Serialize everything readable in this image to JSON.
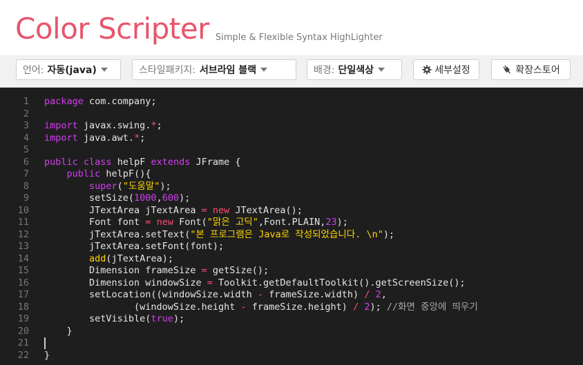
{
  "brand": {
    "logo_text": "Color Scripter",
    "tagline": "Simple & Flexible Syntax HighLighter"
  },
  "toolbar": {
    "language": {
      "label": "언어:",
      "value": "자동(java)"
    },
    "style_package": {
      "label": "스타일패키지:",
      "value": "서브라임 블랙"
    },
    "background": {
      "label": "배경:",
      "value": "단일색상"
    },
    "settings_label": "세부설정",
    "extensions_label": "확장스토어"
  },
  "editor": {
    "line_numbers": [
      "1",
      "2",
      "3",
      "4",
      "5",
      "6",
      "7",
      "8",
      "9",
      "10",
      "11",
      "12",
      "13",
      "14",
      "15",
      "16",
      "17",
      "18",
      "19",
      "20",
      "21",
      "22"
    ],
    "cursor_line": 21,
    "lines": [
      [
        {
          "t": "kw",
          "v": "package"
        },
        {
          "t": "pl",
          "v": " com.company;"
        }
      ],
      [],
      [
        {
          "t": "kw",
          "v": "import"
        },
        {
          "t": "pl",
          "v": " javax.swing."
        },
        {
          "t": "op",
          "v": "*"
        },
        {
          "t": "pl",
          "v": ";"
        }
      ],
      [
        {
          "t": "kw",
          "v": "import"
        },
        {
          "t": "pl",
          "v": " java.awt."
        },
        {
          "t": "op",
          "v": "*"
        },
        {
          "t": "pl",
          "v": ";"
        }
      ],
      [],
      [
        {
          "t": "kw",
          "v": "public"
        },
        {
          "t": "pl",
          "v": " "
        },
        {
          "t": "kw",
          "v": "class"
        },
        {
          "t": "pl",
          "v": " helpF "
        },
        {
          "t": "kw",
          "v": "extends"
        },
        {
          "t": "pl",
          "v": " JFrame {"
        }
      ],
      [
        {
          "t": "pl",
          "v": "    "
        },
        {
          "t": "kw",
          "v": "public"
        },
        {
          "t": "pl",
          "v": " helpF(){"
        }
      ],
      [
        {
          "t": "pl",
          "v": "        "
        },
        {
          "t": "kw",
          "v": "super"
        },
        {
          "t": "pl",
          "v": "("
        },
        {
          "t": "str",
          "v": "\"도움말\""
        },
        {
          "t": "pl",
          "v": ");"
        }
      ],
      [
        {
          "t": "pl",
          "v": "        setSize("
        },
        {
          "t": "num",
          "v": "1000"
        },
        {
          "t": "pl",
          "v": ","
        },
        {
          "t": "num",
          "v": "600"
        },
        {
          "t": "pl",
          "v": ");"
        }
      ],
      [
        {
          "t": "pl",
          "v": "        JTextArea jTextArea "
        },
        {
          "t": "op",
          "v": "="
        },
        {
          "t": "pl",
          "v": " "
        },
        {
          "t": "op",
          "v": "new"
        },
        {
          "t": "pl",
          "v": " JTextArea();"
        }
      ],
      [
        {
          "t": "pl",
          "v": "        Font font "
        },
        {
          "t": "op",
          "v": "="
        },
        {
          "t": "pl",
          "v": " "
        },
        {
          "t": "op",
          "v": "new"
        },
        {
          "t": "pl",
          "v": " Font("
        },
        {
          "t": "str",
          "v": "\"맑은 고딕\""
        },
        {
          "t": "pl",
          "v": ",Font.PLAIN,"
        },
        {
          "t": "num",
          "v": "23"
        },
        {
          "t": "pl",
          "v": ");"
        }
      ],
      [
        {
          "t": "pl",
          "v": "        jTextArea.setText("
        },
        {
          "t": "str",
          "v": "\"본 프로그램은 Java로 작성되었습니다. \\n\""
        },
        {
          "t": "pl",
          "v": ");"
        }
      ],
      [
        {
          "t": "pl",
          "v": "        jTextArea.setFont(font);"
        }
      ],
      [
        {
          "t": "pl",
          "v": "        "
        },
        {
          "t": "fn",
          "v": "add"
        },
        {
          "t": "pl",
          "v": "(jTextArea);"
        }
      ],
      [
        {
          "t": "pl",
          "v": "        Dimension frameSize "
        },
        {
          "t": "op",
          "v": "="
        },
        {
          "t": "pl",
          "v": " getSize();"
        }
      ],
      [
        {
          "t": "pl",
          "v": "        Dimension windowSize "
        },
        {
          "t": "op",
          "v": "="
        },
        {
          "t": "pl",
          "v": " Toolkit.getDefaultToolkit().getScreenSize();"
        }
      ],
      [
        {
          "t": "pl",
          "v": "        setLocation((windowSize.width "
        },
        {
          "t": "op",
          "v": "-"
        },
        {
          "t": "pl",
          "v": " frameSize.width) "
        },
        {
          "t": "op",
          "v": "/"
        },
        {
          "t": "pl",
          "v": " "
        },
        {
          "t": "num",
          "v": "2"
        },
        {
          "t": "pl",
          "v": ","
        }
      ],
      [
        {
          "t": "pl",
          "v": "                (windowSize.height "
        },
        {
          "t": "op",
          "v": "-"
        },
        {
          "t": "pl",
          "v": " frameSize.height) "
        },
        {
          "t": "op",
          "v": "/"
        },
        {
          "t": "pl",
          "v": " "
        },
        {
          "t": "num",
          "v": "2"
        },
        {
          "t": "pl",
          "v": "); "
        },
        {
          "t": "cm",
          "v": "//화면 중앙에 띄우기"
        }
      ],
      [
        {
          "t": "pl",
          "v": "        setVisible("
        },
        {
          "t": "kw",
          "v": "true"
        },
        {
          "t": "pl",
          "v": ");"
        }
      ],
      [
        {
          "t": "pl",
          "v": "    }"
        }
      ],
      [],
      [
        {
          "t": "pl",
          "v": "}"
        }
      ]
    ]
  },
  "colors": {
    "brand_pink": "#e9546b",
    "editor_bg": "#1e1e1e",
    "keyword": "#d33ff0",
    "operator": "#ff4d74",
    "string": "#ffd500",
    "comment": "#a9a9a9",
    "plain": "#e6e6e6"
  },
  "icons": {
    "settings": "gear-icon",
    "extensions": "plug-icon",
    "dropdown": "caret-down-icon"
  }
}
